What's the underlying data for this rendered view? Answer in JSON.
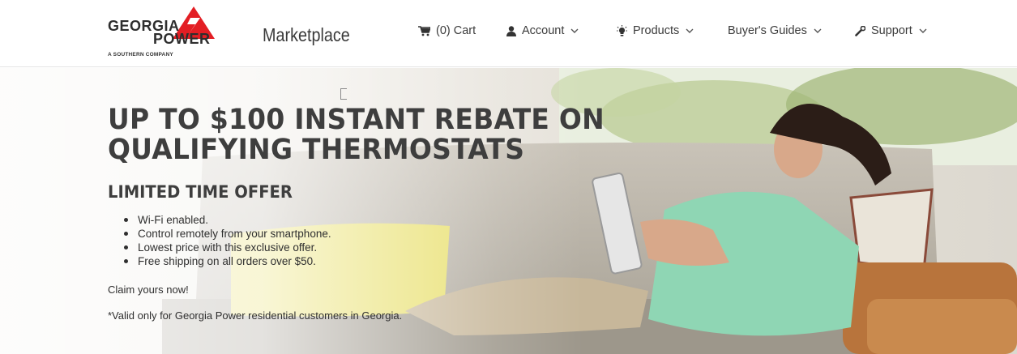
{
  "brand": {
    "logo_line1": "GEORGIA",
    "logo_line2": "POWER",
    "logo_sub": "A SOUTHERN COMPANY",
    "logo_color": "#e31e24",
    "marketplace": "Marketplace"
  },
  "nav": {
    "cart": {
      "label": "(0) Cart",
      "icon": "cart-icon"
    },
    "account": {
      "label": "Account",
      "icon": "user-icon"
    },
    "products": {
      "label": "Products",
      "icon": "lightbulb-icon"
    },
    "buyers_guides": {
      "label": "Buyer's Guides"
    },
    "support": {
      "label": "Support",
      "icon": "wrench-icon"
    }
  },
  "hero": {
    "headline_line1": "UP TO $100 INSTANT REBATE ON",
    "headline_line2": "QUALIFYING THERMOSTATS",
    "subhead": "LIMITED TIME OFFER",
    "bullets": [
      "Wi-Fi enabled.",
      "Control remotely from your smartphone.",
      "Lowest price with this exclusive offer.",
      "Free shipping on all orders over $50."
    ],
    "claim": "Claim yours now!",
    "disclaimer": "*Valid only for Georgia Power residential customers in Georgia."
  }
}
